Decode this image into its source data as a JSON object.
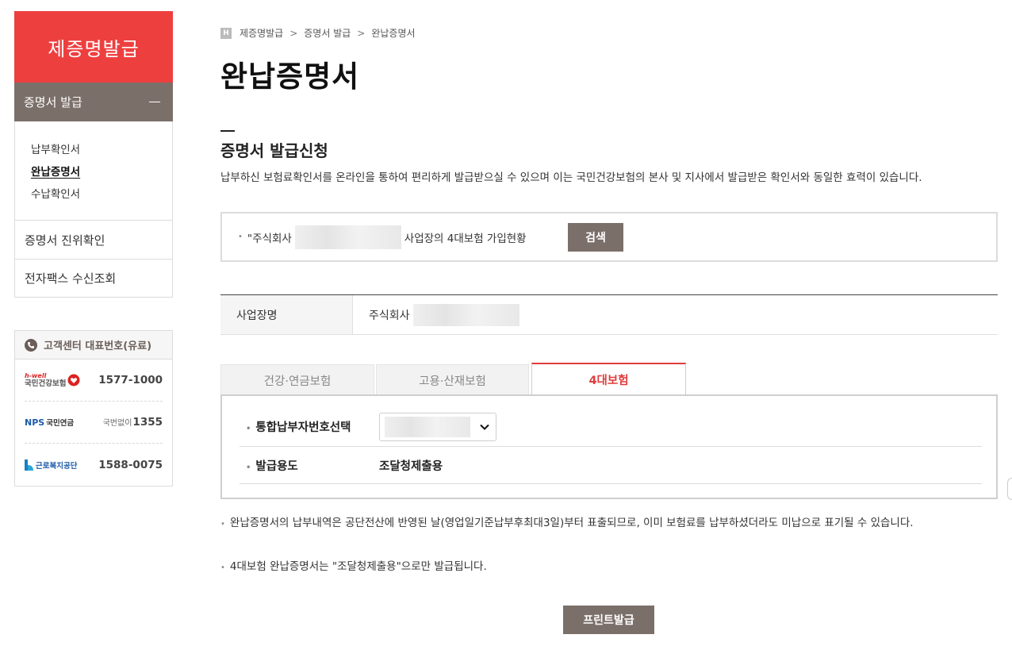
{
  "sidebar": {
    "title": "제증명발급",
    "section": "증명서 발급",
    "sub_items": [
      "납부확인서",
      "완납증명서",
      "수납확인서"
    ],
    "links": [
      "증명서 진위확인",
      "전자팩스 수신조회"
    ]
  },
  "customer_center": {
    "title": "고객센터 대표번호(유료)",
    "rows": [
      {
        "org": "국민건강보험",
        "brand": "h-well",
        "number": "1577-1000"
      },
      {
        "org": "국민연금",
        "brand": "NPS",
        "prefix": "국번없이",
        "number": "1355"
      },
      {
        "org": "근로복지공단",
        "number": "1588-0075"
      }
    ]
  },
  "breadcrumb": {
    "home": "H",
    "items": [
      "제증명발급",
      "증명서 발급",
      "완납증명서"
    ],
    "separator": ">"
  },
  "page_title": "완납증명서",
  "section": {
    "title": "증명서 발급신청",
    "description": "납부하신 보험료확인서를 온라인을 통하여 편리하게 발급받으실 수 있으며 이는 국민건강보험의 본사 및 지사에서 발급받은 확인서와 동일한 효력이 있습니다."
  },
  "search": {
    "prefix": "\"주식회사",
    "suffix": "사업장의 4대보험 가입현황",
    "button": "검색"
  },
  "business": {
    "label": "사업장명",
    "value": "주식회사"
  },
  "tabs": [
    {
      "label": "건강·연금보험",
      "active": false
    },
    {
      "label": "고용·산재보험",
      "active": false
    },
    {
      "label": "4대보험",
      "active": true
    }
  ],
  "form": {
    "payer_label": "통합납부자번호선택",
    "purpose_label": "발급용도",
    "purpose_value": "조달청제출용"
  },
  "notices": [
    "완납증명서의 납부내역은 공단전산에 반영된 날(영업일기준납부후최대3일)부터 표출되므로, 이미 보험료를 납부하셨더라도 미납으로 표기될 수 있습니다.",
    "4대보험 완납증명서는 \"조달청제출용\"으로만 발급됩니다."
  ],
  "print_button": "프린트발급",
  "colors": {
    "accent_red": "#ee3f3f",
    "brown": "#7b6f6a"
  }
}
